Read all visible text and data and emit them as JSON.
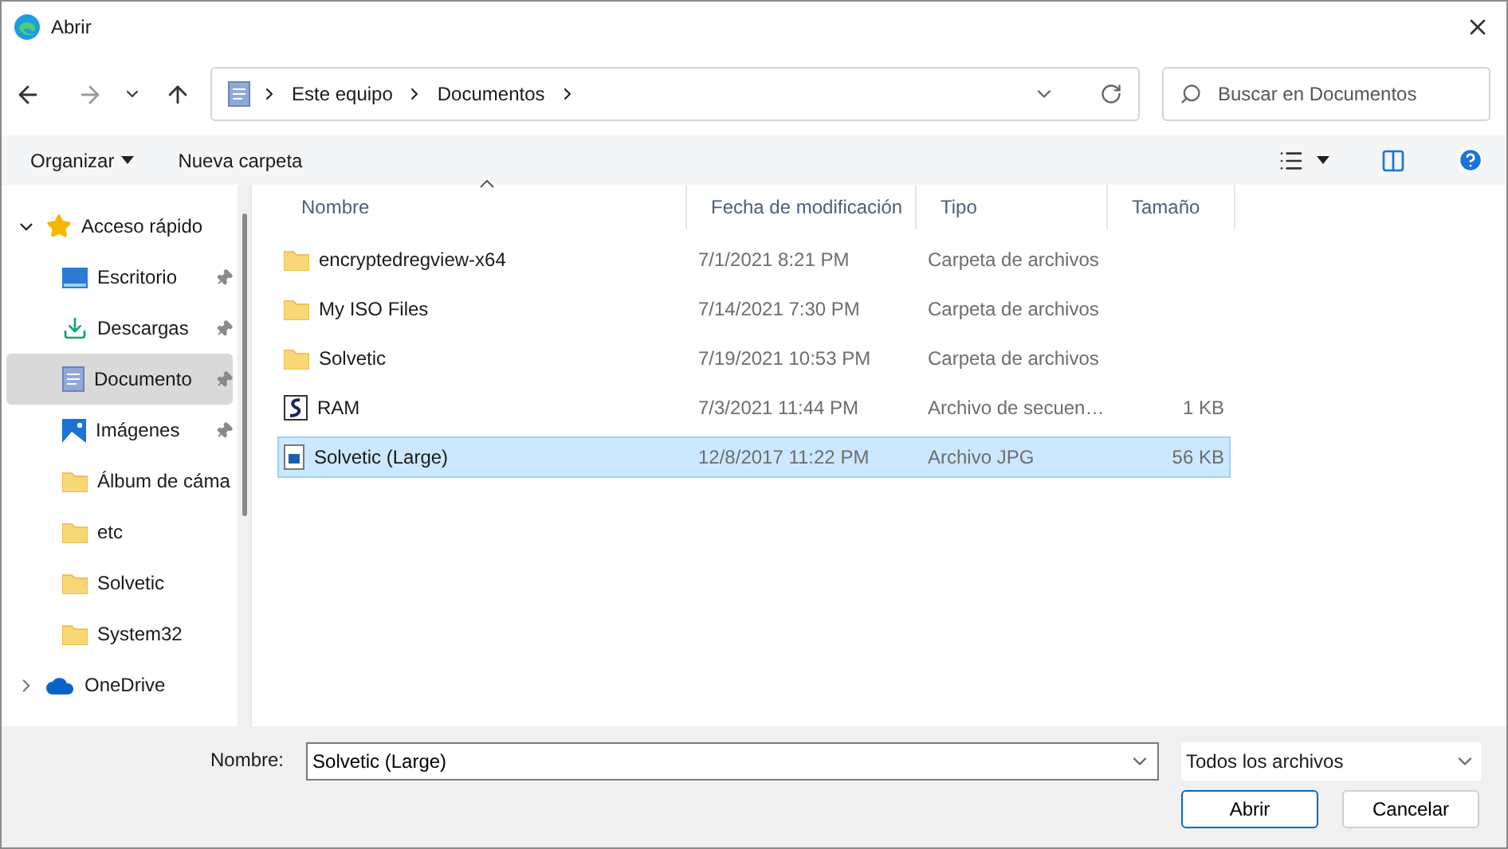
{
  "window": {
    "title": "Abrir"
  },
  "address": {
    "crumbs": [
      "Este equipo",
      "Documentos"
    ]
  },
  "search": {
    "placeholder": "Buscar en Documentos"
  },
  "commands": [
    "Organizar",
    "Nueva carpeta"
  ],
  "sidebar": {
    "items": [
      {
        "label": "Acceso rápido",
        "kind": "star",
        "expanded": true,
        "children": [
          {
            "label": "Escritorio",
            "kind": "desktop",
            "pinned": true,
            "selected": false
          },
          {
            "label": "Descargas",
            "kind": "download",
            "pinned": true,
            "selected": false
          },
          {
            "label": "Documento",
            "kind": "document",
            "pinned": true,
            "selected": true
          },
          {
            "label": "Imágenes",
            "kind": "pictures",
            "pinned": true,
            "selected": false
          },
          {
            "label": "Álbum de cáma",
            "kind": "folder",
            "pinned": false,
            "selected": false
          },
          {
            "label": "etc",
            "kind": "folder",
            "pinned": false,
            "selected": false
          },
          {
            "label": "Solvetic",
            "kind": "folder",
            "pinned": false,
            "selected": false
          },
          {
            "label": "System32",
            "kind": "folder",
            "pinned": false,
            "selected": false
          }
        ]
      },
      {
        "label": "OneDrive",
        "kind": "cloud",
        "expanded": false
      }
    ]
  },
  "table": {
    "sorted_ascending": true,
    "columns": [
      {
        "label": "Nombre"
      },
      {
        "label": "Fecha de modificación"
      },
      {
        "label": "Tipo"
      },
      {
        "label": "Tamaño"
      }
    ],
    "rows": [
      {
        "name": "encryptedregview-x64",
        "date": "7/1/2021 8:21 PM",
        "type": "Carpeta de archivos",
        "kind": "folder",
        "selected": false
      },
      {
        "name": "My ISO Files",
        "date": "7/14/2021 7:30 PM",
        "type": "Carpeta de archivos",
        "kind": "folder",
        "selected": false
      },
      {
        "name": "Solvetic",
        "date": "7/19/2021 10:53 PM",
        "type": "Carpeta de archivos",
        "kind": "folder",
        "selected": false
      },
      {
        "name": "RAM",
        "date": "7/3/2021 11:44 PM",
        "type": "Archivo de secuen…",
        "size": "1 KB",
        "kind": "script",
        "selected": false
      },
      {
        "name": "Solvetic (Large)",
        "date": "12/8/2017 11:22 PM",
        "type": "Archivo JPG",
        "size": "56 KB",
        "kind": "image",
        "selected": true
      }
    ]
  },
  "footer": {
    "name_label": "Nombre:",
    "name_value": "Solvetic (Large)",
    "filter": "Todos los archivos",
    "buttons": [
      {
        "label": "Abrir",
        "default": true
      },
      {
        "label": "Cancelar",
        "default": false
      }
    ]
  }
}
